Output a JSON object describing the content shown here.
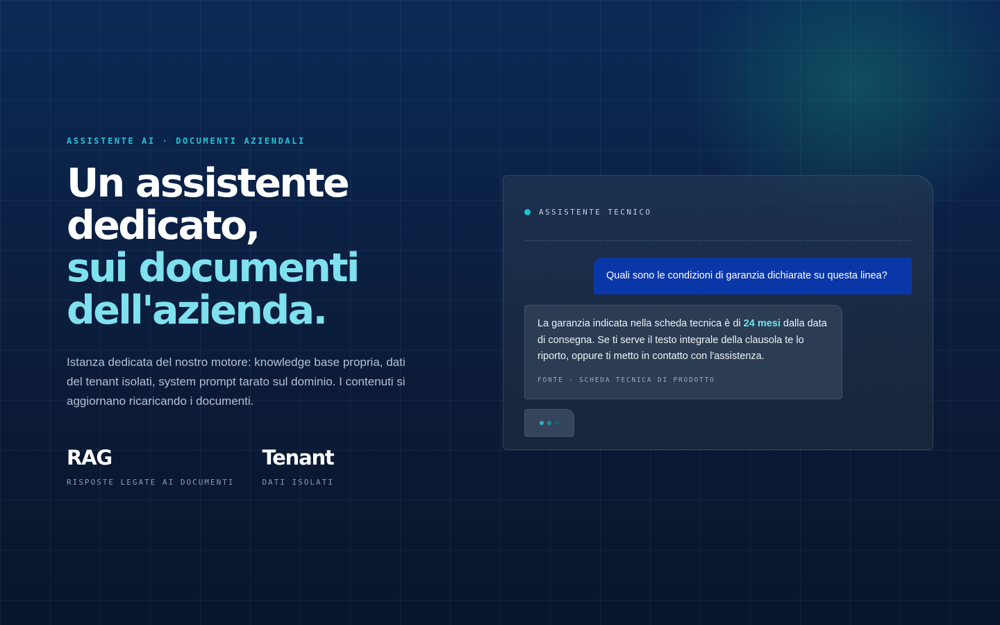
{
  "hero": {
    "eyebrow": "ASSISTENTE AI · DOCUMENTI AZIENDALI",
    "headline_line1": "Un assistente",
    "headline_line2": "dedicato,",
    "headline_line3": "sui documenti",
    "headline_line4": "dell'azienda.",
    "lead": "Istanza dedicata del nostro motore: knowledge base propria, dati del tenant isolati, system prompt tarato sul dominio. I contenuti si aggiornano ricaricando i documenti.",
    "stats": [
      {
        "value": "RAG",
        "label": "RISPOSTE LEGATE AI DOCUMENTI"
      },
      {
        "value": "Tenant",
        "label": "DATI ISOLATI"
      }
    ]
  },
  "chat": {
    "title": "ASSISTENTE TECNICO",
    "user_message": "Quali sono le condizioni di garanzia dichiarate su questa linea?",
    "bot_message_before": "La garanzia indicata nella scheda tecnica è di ",
    "bot_message_highlight": "24 mesi",
    "bot_message_after": " dalla data di consegna. Se ti serve il testo integrale della clausola te lo riporto, oppure ti metto in contatto con l'assistenza.",
    "source": "FONTE · SCHEDA TECNICA DI PRODOTTO"
  },
  "colors": {
    "accent": "#22c3d6",
    "headline_cyan": "#7fe0ee",
    "user_bubble": "#0a37a8",
    "typing_dot_1": "#1fb5c8",
    "typing_dot_2": "#1a8fa2",
    "typing_dot_3": "#17606f"
  }
}
